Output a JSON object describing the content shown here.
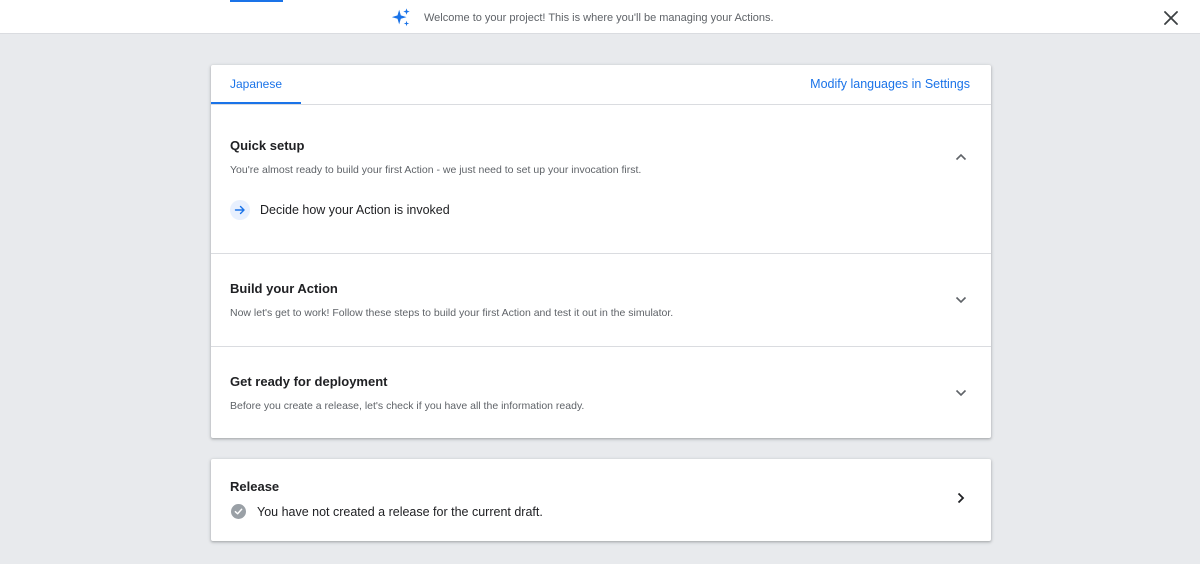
{
  "banner": {
    "message": "Welcome to your project! This is where you'll be managing your Actions.",
    "icon": "sparkle-icon"
  },
  "tabs": [
    {
      "label": "Japanese",
      "active": true
    }
  ],
  "settings_link": "Modify languages in Settings",
  "sections": {
    "quick_setup": {
      "title": "Quick setup",
      "description": "You're almost ready to build your first Action - we just need to set up your invocation first.",
      "expanded": true,
      "step": "Decide how your Action is invoked"
    },
    "build": {
      "title": "Build your Action",
      "description": "Now let's get to work! Follow these steps to build your first Action and test it out in the simulator.",
      "expanded": false
    },
    "deploy": {
      "title": "Get ready for deployment",
      "description": "Before you create a release, let's check if you have all the information ready.",
      "expanded": false
    }
  },
  "release": {
    "title": "Release",
    "status": "You have not created a release for the current draft."
  },
  "colors": {
    "accent": "#1a73e8",
    "background": "#e8eaed",
    "muted_text": "#5f6368",
    "status_gray": "#9aa0a6"
  }
}
